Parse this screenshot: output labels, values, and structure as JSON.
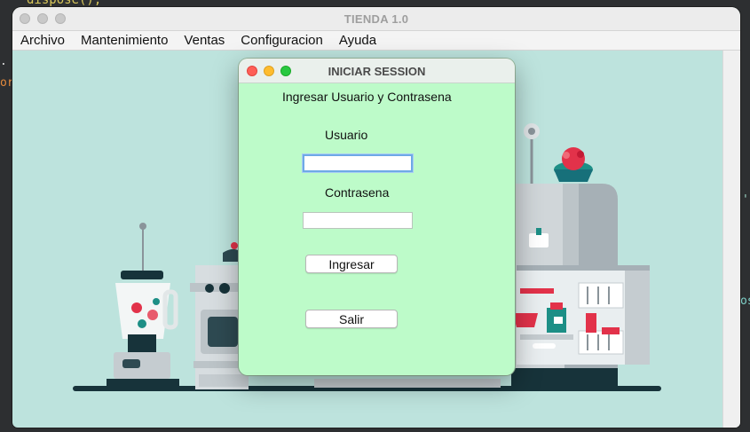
{
  "ide": {
    "code_fragment": "dispose();",
    "fragment_left_1": ".",
    "fragment_left_2": "or",
    "fragment_right_1": "',",
    "fragment_right_2": "os"
  },
  "main_window": {
    "title": "TIENDA 1.0",
    "menu": [
      "Archivo",
      "Mantenimiento",
      "Ventas",
      "Configuracion",
      "Ayuda"
    ]
  },
  "login_dialog": {
    "title": "INICIAR SESSION",
    "subtitle": "Ingresar Usuario y Contrasena",
    "user_label": "Usuario",
    "user_value": "",
    "password_label": "Contrasena",
    "password_value": "",
    "login_button": "Ingresar",
    "exit_button": "Salir"
  },
  "colors": {
    "dialog_background": "#bdfbc9",
    "window_background": "#bde3dd",
    "close": "#fe5f57",
    "minimize": "#febc2e",
    "zoom": "#28c840"
  }
}
